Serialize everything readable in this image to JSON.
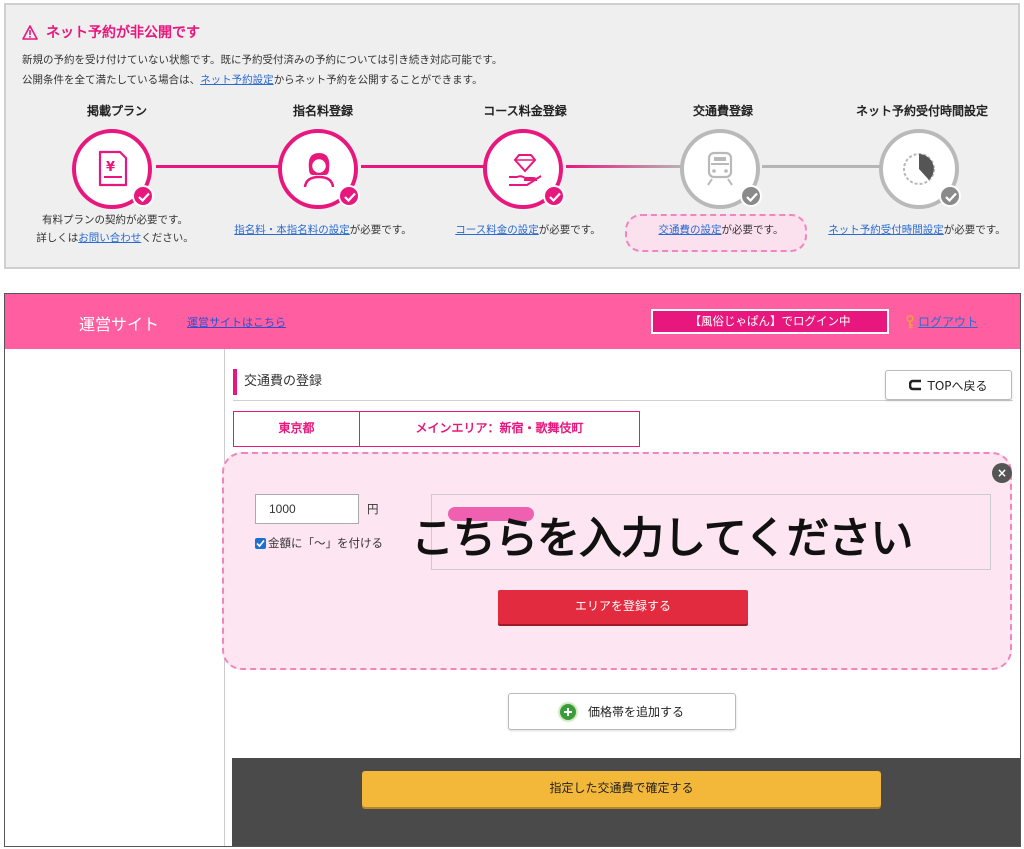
{
  "notice": {
    "title": "ネット予約が非公開です",
    "line1": "新規の予約を受け付けていない状態です。既に予約受付済みの予約については引き続き対応可能です。",
    "line2_prefix": "公開条件を全て満たしている場合は、",
    "line2_link": "ネット予約設定",
    "line2_suffix": "からネット予約を公開することができます。",
    "steps": [
      {
        "title": "掲載プラン",
        "icon": "yen-document-icon",
        "done": true,
        "note_line1": "有料プランの契約が必要です。",
        "note_line2_prefix": "詳しくは",
        "note_line2_link": "お問い合わせ",
        "note_line2_suffix": "ください。"
      },
      {
        "title": "指名料登録",
        "icon": "woman-avatar-icon",
        "done": true,
        "note_link": "指名料・本指名料の設定",
        "note_suffix": "が必要です。"
      },
      {
        "title": "コース料金登録",
        "icon": "diamond-hand-icon",
        "done": true,
        "note_link": "コース料金の設定",
        "note_suffix": "が必要です。"
      },
      {
        "title": "交通費登録",
        "icon": "train-icon",
        "done": false,
        "note_link": "交通費の設定",
        "note_suffix": "が必要です。"
      },
      {
        "title": "ネット予約受付時間設定",
        "icon": "clock-icon",
        "done": false,
        "note_link": "ネット予約受付時間設定",
        "note_suffix": "が必要です。"
      }
    ]
  },
  "header": {
    "site_title": "運営サイト",
    "site_link": "運営サイトはこちら",
    "login_status": "【風俗じゃぱん】でログイン中",
    "logout": "ログアウト"
  },
  "page": {
    "title": "交通費の登録",
    "back_button": "TOPへ戻る",
    "prefecture": "東京都",
    "main_area": "メインエリア：新宿・歌舞伎町"
  },
  "form": {
    "price_value": "1000",
    "yen_label": "円",
    "tilde_label": "金額に「～」を付ける",
    "tilde_checked": true,
    "hint_text": "こちらを入力してください",
    "register_area_button": "エリアを登録する",
    "close_symbol": "×"
  },
  "actions": {
    "add_price_band": "価格帯を追加する",
    "confirm": "指定した交通費で確定する"
  },
  "colors": {
    "accent": "#e8177d",
    "header_bg": "#ff5fa0",
    "register_btn": "#e22b3e",
    "confirm_btn": "#f3b73a"
  }
}
